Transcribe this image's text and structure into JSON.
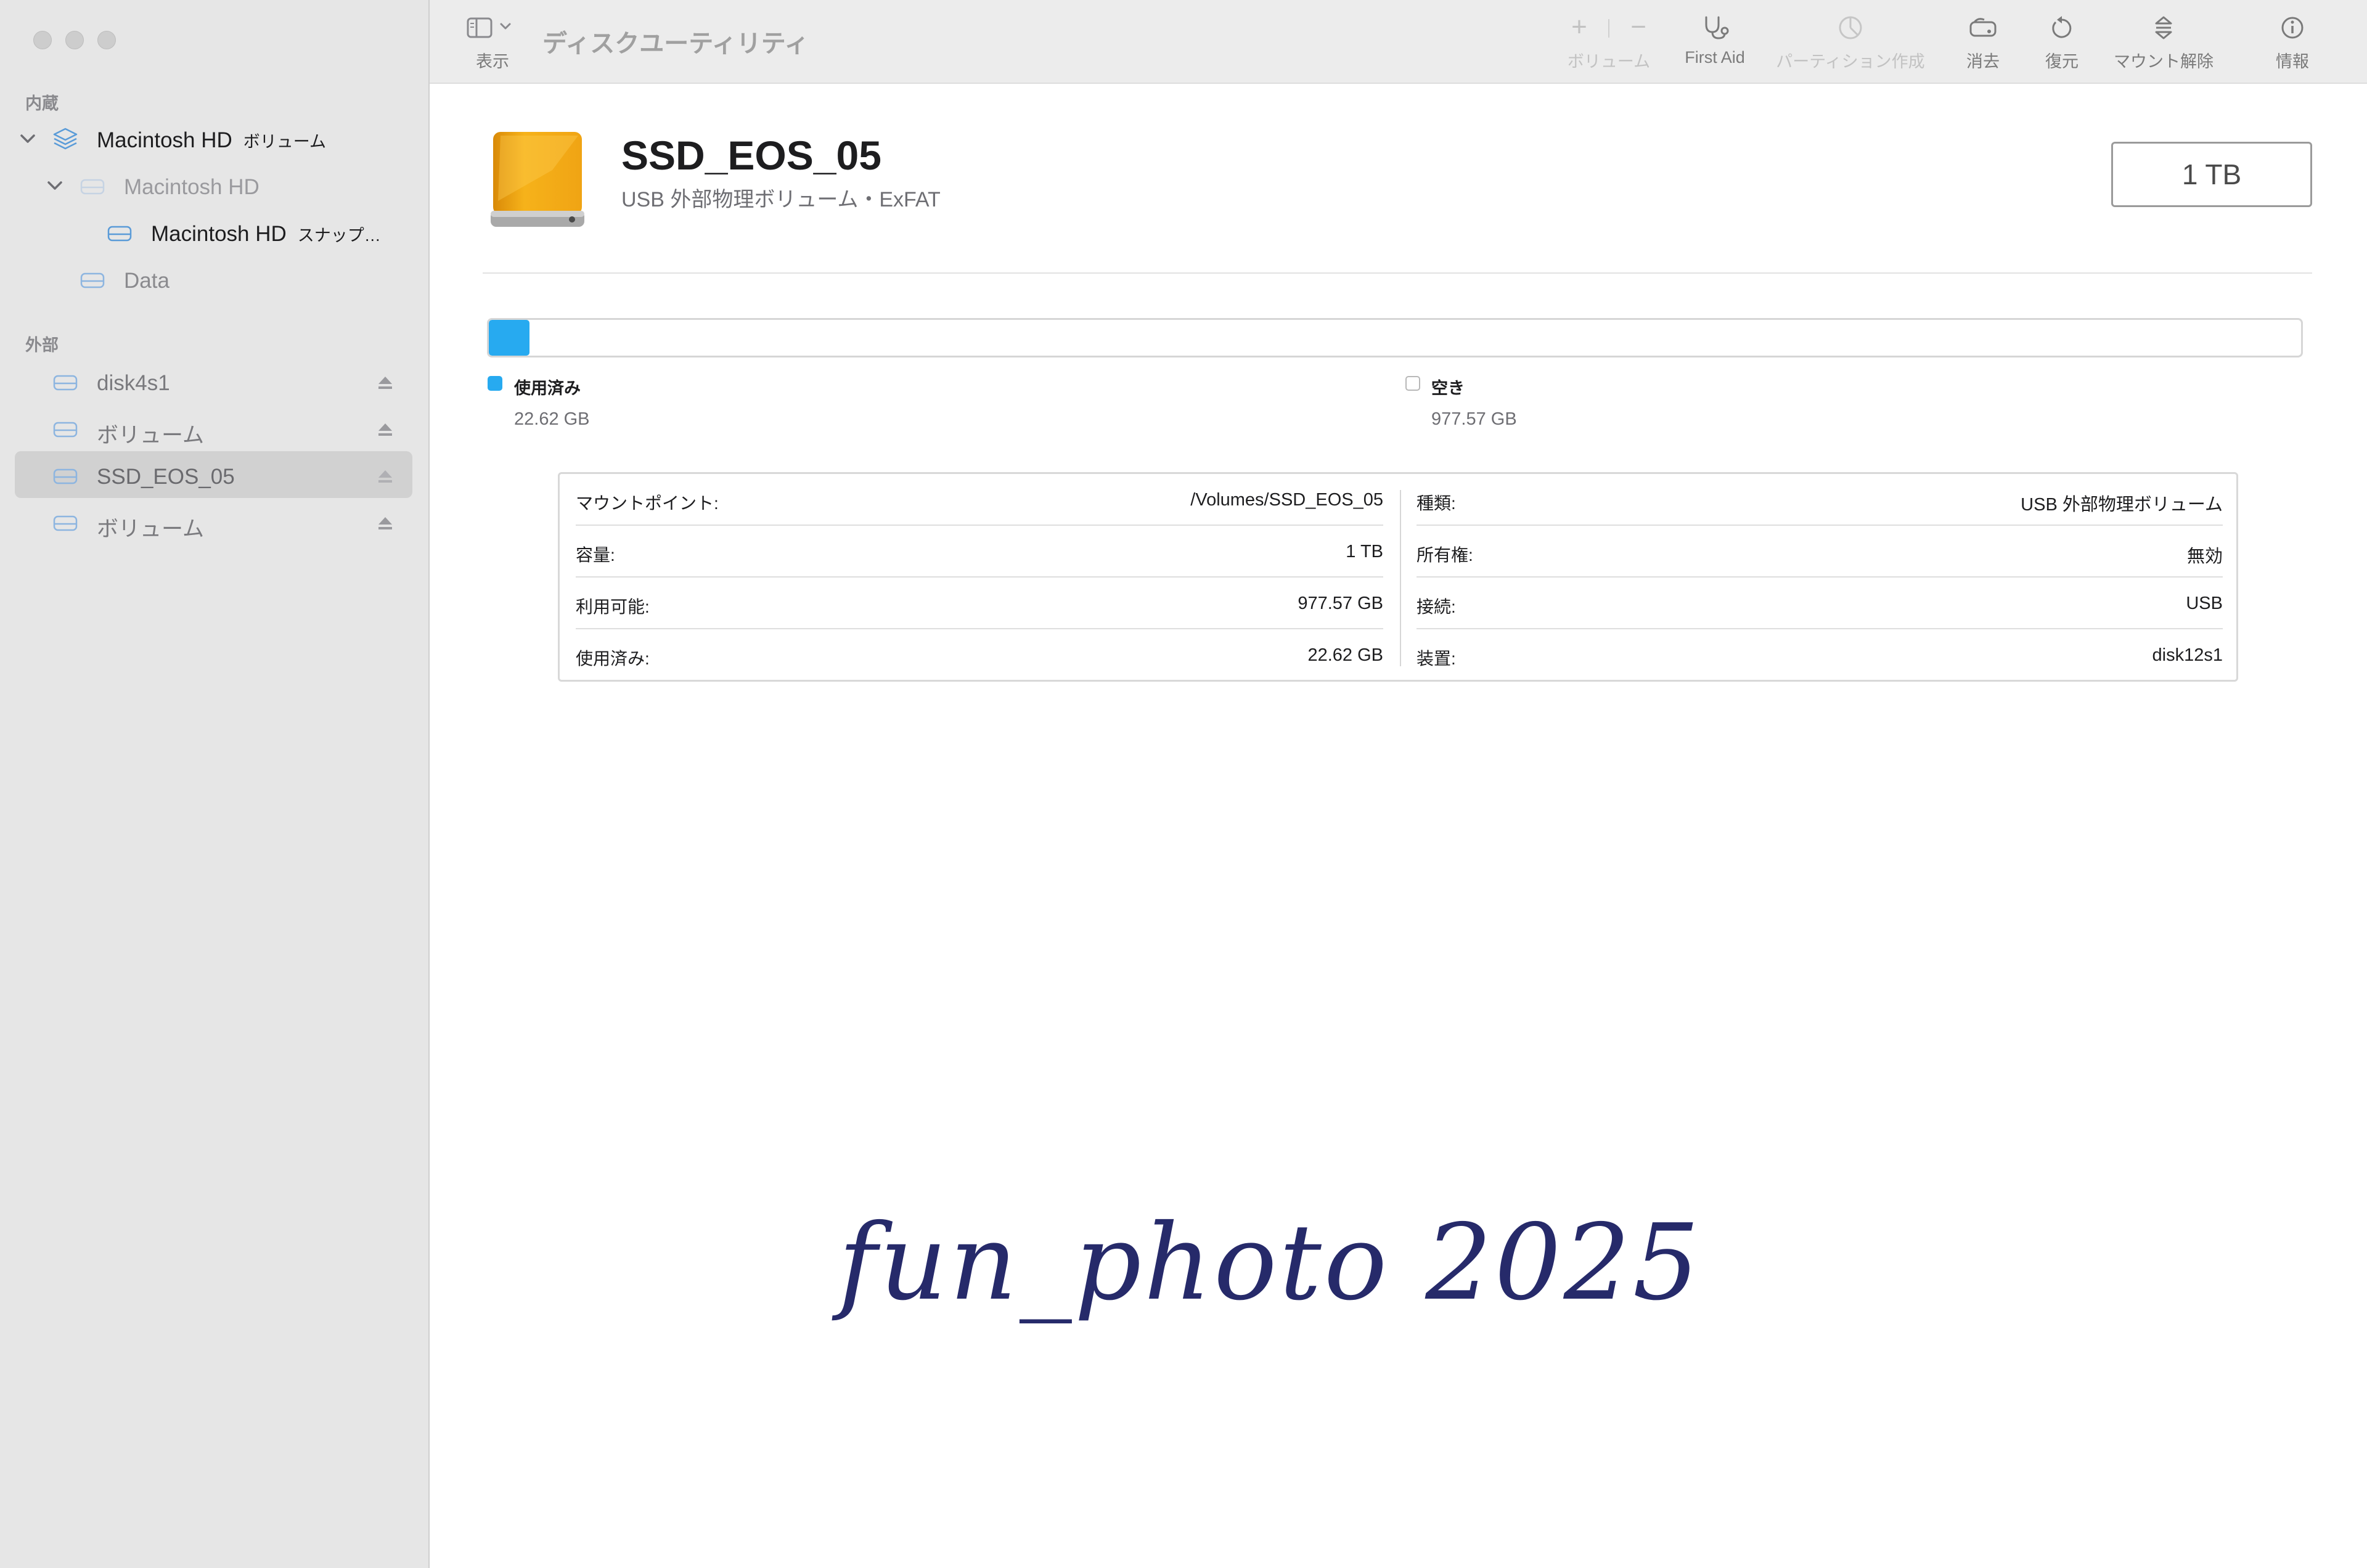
{
  "window": {
    "title": "ディスクユーティリティ"
  },
  "toolbar": {
    "view_label": "表示",
    "volume_add_label": "+",
    "volume_remove_label": "−",
    "volume_label": "ボリューム",
    "first_aid_label": "First Aid",
    "partition_label": "パーティション作成",
    "erase_label": "消去",
    "restore_label": "復元",
    "unmount_label": "マウント解除",
    "info_label": "情報"
  },
  "sidebar": {
    "internal_header": "内蔵",
    "external_header": "外部",
    "internal_items": [
      {
        "label": "Macintosh HD",
        "suffix": "ボリューム"
      },
      {
        "label": "Macintosh HD",
        "suffix": ""
      },
      {
        "label": "Macintosh HD",
        "suffix": "スナップ…"
      },
      {
        "label": "Data",
        "suffix": ""
      }
    ],
    "external_items": [
      {
        "label": "disk4s1"
      },
      {
        "label": "ボリューム"
      },
      {
        "label": "SSD_EOS_05",
        "selected": true
      },
      {
        "label": "ボリューム"
      }
    ]
  },
  "volume": {
    "name": "SSD_EOS_05",
    "subtitle": "USB 外部物理ボリューム・ExFAT",
    "capacity": "1 TB"
  },
  "usage": {
    "used_fraction": 0.0226,
    "used_label": "使用済み",
    "used_value": "22.62 GB",
    "free_label": "空き",
    "free_value": "977.57 GB"
  },
  "info": {
    "left": [
      {
        "key": "マウントポイント:",
        "value": "/Volumes/SSD_EOS_05"
      },
      {
        "key": "容量:",
        "value": "1 TB"
      },
      {
        "key": "利用可能:",
        "value": "977.57 GB"
      },
      {
        "key": "使用済み:",
        "value": "22.62 GB"
      }
    ],
    "right": [
      {
        "key": "種類:",
        "value": "USB 外部物理ボリューム"
      },
      {
        "key": "所有権:",
        "value": "無効"
      },
      {
        "key": "接続:",
        "value": "USB"
      },
      {
        "key": "装置:",
        "value": "disk12s1"
      }
    ]
  },
  "watermark": "fun_photo 2025",
  "colors": {
    "accent": "#27aaf0",
    "sidebar_icon": "#5a9bd8",
    "drive_orange": "#f0a818"
  }
}
